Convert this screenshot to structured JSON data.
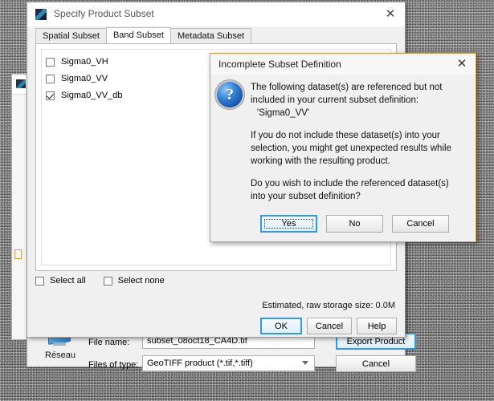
{
  "desktop": {
    "name": "sar-noise-background"
  },
  "back_window": {
    "icon": "snap-app-icon"
  },
  "subset_window": {
    "title": "Specify Product Subset",
    "icon": "snap-app-icon",
    "close_label": "✕",
    "tabs": [
      {
        "label": "Spatial Subset",
        "active": false
      },
      {
        "label": "Band Subset",
        "active": true
      },
      {
        "label": "Metadata Subset",
        "active": false
      }
    ],
    "bands": [
      {
        "label": "Sigma0_VH",
        "checked": false
      },
      {
        "label": "Sigma0_VV",
        "checked": false
      },
      {
        "label": "Sigma0_VV_db",
        "checked": true
      }
    ],
    "select_all": {
      "label": "Select all",
      "checked": false
    },
    "select_none": {
      "label": "Select none",
      "checked": false
    },
    "storage_text": "Estimated, raw storage size: 0.0M",
    "buttons": [
      {
        "label": "OK",
        "focused": true
      },
      {
        "label": "Cancel",
        "focused": false
      },
      {
        "label": "Help",
        "focused": false
      }
    ]
  },
  "modal": {
    "title": "Incomplete Subset Definition",
    "close_label": "✕",
    "icon": "question-mark-icon",
    "icon_glyph": "?",
    "paragraph1": "The following dataset(s) are referenced but not included in your current subset definition:",
    "dataset_name": "'Sigma0_VV'",
    "paragraph2": "If you do not include these dataset(s) into your selection, you might get unexpected results while working with the resulting product.",
    "paragraph3": "Do you wish to include the referenced dataset(s) into your subset definition?",
    "buttons": [
      {
        "label": "Yes",
        "focused": true
      },
      {
        "label": "No",
        "focused": false
      },
      {
        "label": "Cancel",
        "focused": false
      }
    ],
    "border_color": "#d79c4e"
  },
  "file_dialog": {
    "shortcut": {
      "label": "Réseau",
      "icon": "network-computer-icon"
    },
    "file_name_label": "File name:",
    "file_name_value": "subset_08oct18_CA4D.tif",
    "file_type_label": "Files of type:",
    "file_type_value": "GeoTIFF product (*.tif,*.tiff)",
    "export_button": {
      "label": "Export Product",
      "focused": true
    },
    "cancel_button": {
      "label": "Cancel",
      "focused": false
    }
  }
}
